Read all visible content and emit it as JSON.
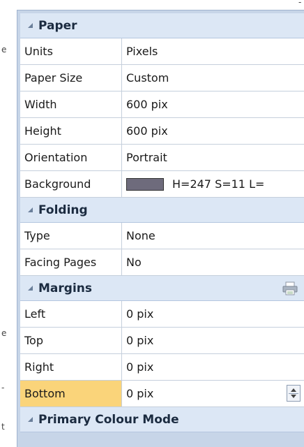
{
  "edge": {
    "top_right": "-",
    "left_1": "e",
    "left_2": "e",
    "left_3": "-",
    "left_4": "t"
  },
  "colors": {
    "background_swatch": "#6e6b7c"
  },
  "sections": {
    "paper": {
      "title": "Paper",
      "rows": [
        {
          "label": "Units",
          "value": "Pixels"
        },
        {
          "label": "Paper Size",
          "value": "Custom"
        },
        {
          "label": "Width",
          "value": "600 pix"
        },
        {
          "label": "Height",
          "value": "600 pix"
        },
        {
          "label": "Orientation",
          "value": "Portrait"
        },
        {
          "label": "Background",
          "value": "H=247 S=11 L="
        }
      ]
    },
    "folding": {
      "title": "Folding",
      "rows": [
        {
          "label": "Type",
          "value": "None"
        },
        {
          "label": "Facing Pages",
          "value": "No"
        }
      ]
    },
    "margins": {
      "title": "Margins",
      "icon": "printer-icon",
      "rows": [
        {
          "label": "Left",
          "value": "0 pix"
        },
        {
          "label": "Top",
          "value": "0 pix"
        },
        {
          "label": "Right",
          "value": "0 pix"
        },
        {
          "label": "Bottom",
          "value": "0 pix"
        }
      ]
    },
    "colour_mode": {
      "title": "Primary Colour Mode"
    }
  }
}
